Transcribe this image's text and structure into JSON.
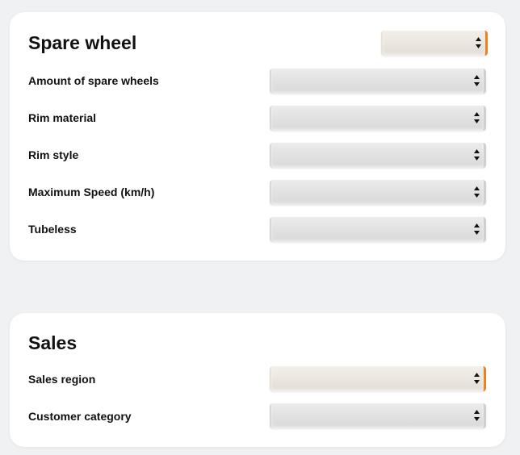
{
  "sections": [
    {
      "title": "Spare wheel",
      "header_select_value": "",
      "rows": [
        {
          "label": "Amount of spare wheels",
          "value": ""
        },
        {
          "label": "Rim material",
          "value": ""
        },
        {
          "label": "Rim style",
          "value": ""
        },
        {
          "label": "Maximum Speed (km/h)",
          "value": ""
        },
        {
          "label": "Tubeless",
          "value": ""
        }
      ]
    },
    {
      "title": "Sales",
      "rows": [
        {
          "label": "Sales region",
          "value": ""
        },
        {
          "label": "Customer category",
          "value": ""
        }
      ]
    }
  ],
  "colors": {
    "page_background": "#f0f1f3",
    "card_background": "#ffffff",
    "accent": "#f07f1e"
  },
  "icons": {
    "select_arrow": "up-down-chevron-icon"
  }
}
